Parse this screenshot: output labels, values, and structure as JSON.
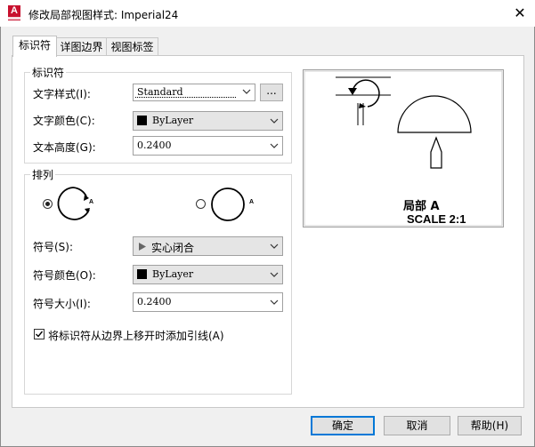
{
  "window": {
    "title": "修改局部视图样式: Imperial24",
    "app_icon_letter": "A",
    "close_glyph": "✕"
  },
  "tabs": [
    {
      "label": "标识符",
      "active": true
    },
    {
      "label": "详图边界",
      "active": false
    },
    {
      "label": "视图标签",
      "active": false
    }
  ],
  "identifier_group": {
    "title": "标识符",
    "text_style_label": "文字样式(I):",
    "text_style_value": "Standard",
    "browse_label": "...",
    "text_color_label": "文字颜色(C):",
    "text_color_value": "ByLayer",
    "text_height_label": "文本高度(G):",
    "text_height_value": "0.2400"
  },
  "arrangement_group": {
    "title": "排列",
    "option1_letter": "A",
    "option2_letter": "A",
    "symbol_label": "符号(S):",
    "symbol_value": "实心闭合",
    "symbol_color_label": "符号颜色(O):",
    "symbol_color_value": "ByLayer",
    "symbol_size_label": "符号大小(I):",
    "symbol_size_value": "0.2400",
    "leader_checkbox_label": "将标识符从边界上移开时添加引线(A)",
    "leader_checked": true
  },
  "preview": {
    "label_line1": "局部 A",
    "label_line2": "SCALE 2:1"
  },
  "footer": {
    "ok_label": "确定",
    "cancel_label": "取消",
    "help_label": "帮助(H)"
  }
}
